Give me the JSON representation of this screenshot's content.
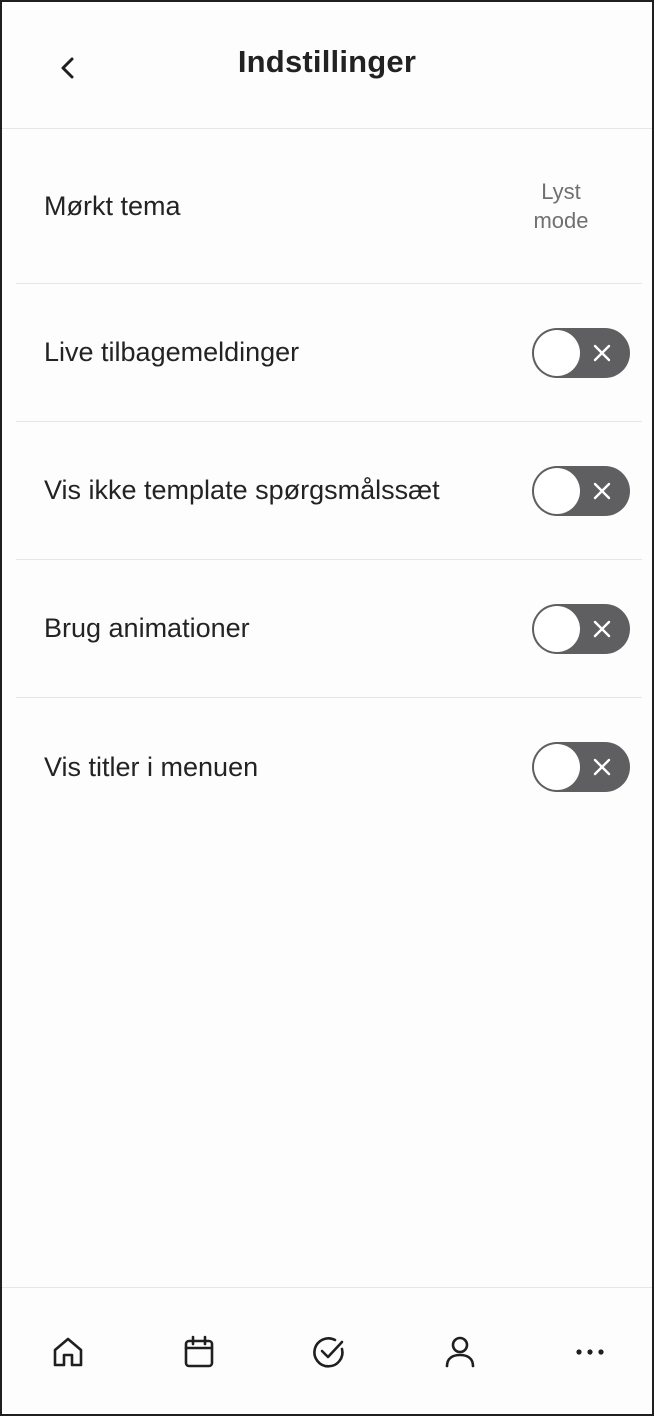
{
  "header": {
    "title": "Indstillinger",
    "back_icon": "chevron-left-icon"
  },
  "settings": {
    "theme": {
      "label": "Mørkt tema",
      "value_line1": "Lyst",
      "value_line2": "mode"
    },
    "toggles": [
      {
        "label": "Live tilbagemeldinger",
        "enabled": false
      },
      {
        "label": "Vis ikke template spørgsmålssæt",
        "enabled": false
      },
      {
        "label": "Brug animationer",
        "enabled": false
      },
      {
        "label": "Vis titler i menuen",
        "enabled": false
      }
    ]
  },
  "bottom_nav": {
    "items": [
      {
        "icon": "home-icon"
      },
      {
        "icon": "calendar-icon"
      },
      {
        "icon": "check-circle-icon"
      },
      {
        "icon": "user-icon"
      },
      {
        "icon": "more-icon"
      }
    ]
  },
  "colors": {
    "toggle_off": "#5f5f62",
    "text": "#232323",
    "muted_text": "#707070",
    "divider": "#e6e6e6"
  }
}
